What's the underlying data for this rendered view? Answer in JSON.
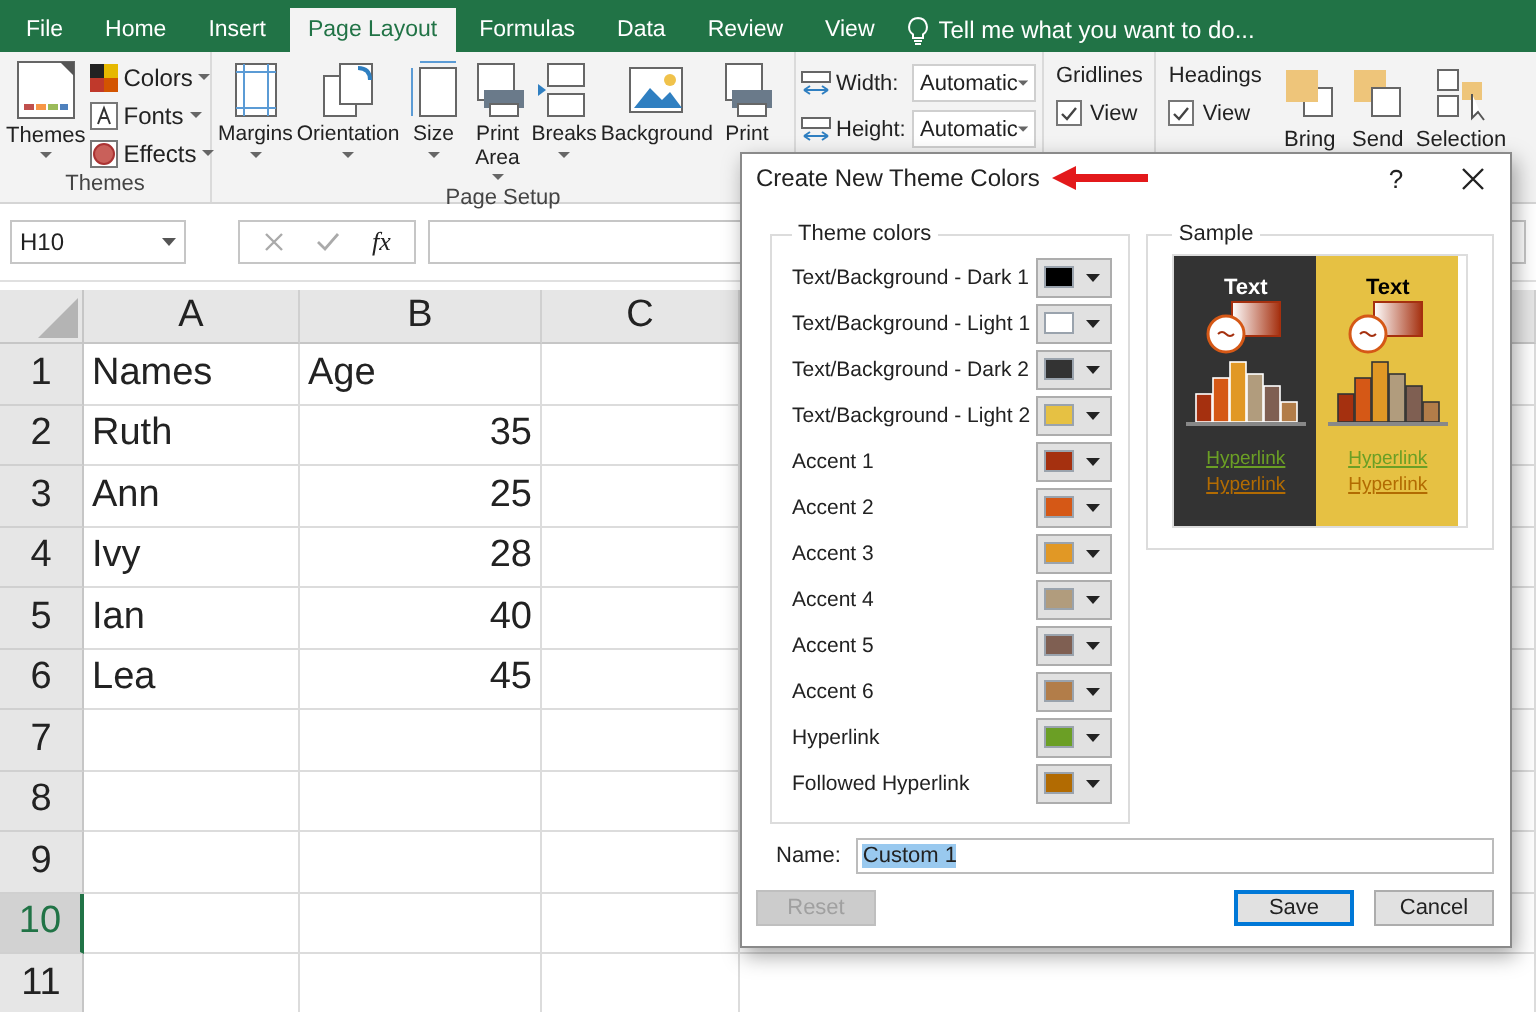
{
  "ribbon_tabs": [
    {
      "label": "File",
      "selected": false
    },
    {
      "label": "Home",
      "selected": false
    },
    {
      "label": "Insert",
      "selected": false
    },
    {
      "label": "Page Layout",
      "selected": true
    },
    {
      "label": "Formulas",
      "selected": false
    },
    {
      "label": "Data",
      "selected": false
    },
    {
      "label": "Review",
      "selected": false
    },
    {
      "label": "View",
      "selected": false
    }
  ],
  "tell_me": {
    "placeholder": "Tell me what you want to do..."
  },
  "themes_group": {
    "label": "Themes",
    "themes_button": "Themes",
    "small_buttons": [
      "Colors",
      "Fonts",
      "Effects"
    ]
  },
  "page_setup_group": {
    "label": "Page Setup",
    "buttons": [
      "Margins",
      "Orientation",
      "Size",
      "Print Area",
      "Breaks",
      "Background",
      "Print"
    ]
  },
  "scale_fields": [
    {
      "label": "Width:",
      "value": "Automatic"
    },
    {
      "label": "Height:",
      "value": "Automatic"
    }
  ],
  "sheet_options": [
    {
      "heading": "Gridlines",
      "view_label": "View",
      "checked": true
    },
    {
      "heading": "Headings",
      "view_label": "View",
      "checked": true
    }
  ],
  "arrange_buttons": [
    "Bring",
    "Send",
    "Selection"
  ],
  "formula_bar": {
    "name_box": "H10",
    "function_label": "fx"
  },
  "sheet": {
    "columns": [
      {
        "label": "A"
      },
      {
        "label": "B"
      },
      {
        "label": "C"
      }
    ],
    "rows": [
      {
        "number": "1",
        "selected": false,
        "cells": [
          {
            "text": "Names",
            "kind": "text"
          },
          {
            "text": "Age",
            "kind": "text"
          }
        ]
      },
      {
        "number": "2",
        "selected": false,
        "cells": [
          {
            "text": "Ruth",
            "kind": "text"
          },
          {
            "text": "35",
            "kind": "number"
          }
        ]
      },
      {
        "number": "3",
        "selected": false,
        "cells": [
          {
            "text": "Ann",
            "kind": "text"
          },
          {
            "text": "25",
            "kind": "number"
          }
        ]
      },
      {
        "number": "4",
        "selected": false,
        "cells": [
          {
            "text": "Ivy",
            "kind": "text"
          },
          {
            "text": "28",
            "kind": "number"
          }
        ]
      },
      {
        "number": "5",
        "selected": false,
        "cells": [
          {
            "text": "Ian",
            "kind": "text"
          },
          {
            "text": "40",
            "kind": "number"
          }
        ]
      },
      {
        "number": "6",
        "selected": false,
        "cells": [
          {
            "text": "Lea",
            "kind": "text"
          },
          {
            "text": "45",
            "kind": "number"
          }
        ]
      },
      {
        "number": "7",
        "selected": false,
        "cells": []
      },
      {
        "number": "8",
        "selected": false,
        "cells": []
      },
      {
        "number": "9",
        "selected": false,
        "cells": []
      },
      {
        "number": "10",
        "selected": true,
        "cells": []
      },
      {
        "number": "11",
        "selected": false,
        "cells": []
      }
    ]
  },
  "dialog": {
    "title": "Create New Theme Colors",
    "help_button": "?",
    "theme_colors": {
      "legend": "Theme colors",
      "items": [
        {
          "label": "Text/Background - Dark 1",
          "color": "#000000"
        },
        {
          "label": "Text/Background - Light 1",
          "color": "#ffffff"
        },
        {
          "label": "Text/Background - Dark 2",
          "color": "#333333"
        },
        {
          "label": "Text/Background - Light 2",
          "color": "#e6c143"
        },
        {
          "label": "Accent 1",
          "color": "#a5300f"
        },
        {
          "label": "Accent 2",
          "color": "#d55816"
        },
        {
          "label": "Accent 3",
          "color": "#e19825"
        },
        {
          "label": "Accent 4",
          "color": "#b19c7d"
        },
        {
          "label": "Accent 5",
          "color": "#7f5f52"
        },
        {
          "label": "Accent 6",
          "color": "#b27d49"
        },
        {
          "label": "Hyperlink",
          "color": "#6b9f25"
        },
        {
          "label": "Followed Hyperlink",
          "color": "#b26b02"
        }
      ]
    },
    "sample": {
      "legend": "Sample",
      "panels": [
        {
          "text": "Text",
          "hyperlink": "Hyperlink",
          "followed_hyperlink": "Hyperlink"
        },
        {
          "text": "Text",
          "hyperlink": "Hyperlink",
          "followed_hyperlink": "Hyperlink"
        }
      ]
    },
    "name_field": {
      "label": "Name:",
      "value": "Custom 1"
    },
    "buttons": [
      {
        "label": "Reset",
        "disabled": true,
        "default": false
      },
      {
        "label": "Save",
        "disabled": false,
        "default": true
      },
      {
        "label": "Cancel",
        "disabled": false,
        "default": false
      }
    ]
  }
}
